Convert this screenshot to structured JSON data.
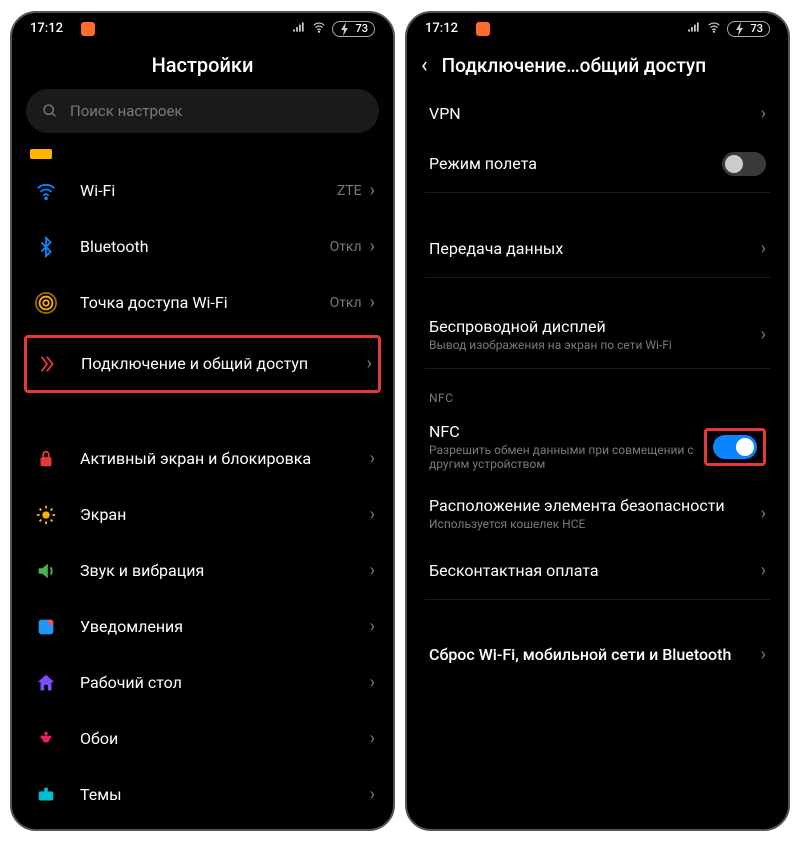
{
  "status": {
    "time": "17:12",
    "battery": "73"
  },
  "left_screen": {
    "title": "Настройки",
    "search_placeholder": "Поиск настроек",
    "items": {
      "wifi": {
        "label": "Wi-Fi",
        "value": "ZTE"
      },
      "bluetooth": {
        "label": "Bluetooth",
        "value": "Откл"
      },
      "hotspot": {
        "label": "Точка доступа Wi-Fi",
        "value": "Откл"
      },
      "sharing": {
        "label": "Подключение и общий доступ"
      },
      "lock": {
        "label": "Активный экран и блокировка"
      },
      "display": {
        "label": "Экран"
      },
      "sound": {
        "label": "Звук и вибрация"
      },
      "notif": {
        "label": "Уведомления"
      },
      "home": {
        "label": "Рабочий стол"
      },
      "wallpaper": {
        "label": "Обои"
      },
      "themes": {
        "label": "Темы"
      }
    }
  },
  "right_screen": {
    "title": "Подключение…общий доступ",
    "items": {
      "vpn": {
        "label": "VPN"
      },
      "airplane": {
        "label": "Режим полета"
      },
      "data": {
        "label": "Передача данных"
      },
      "cast": {
        "label": "Беспроводной дисплей",
        "sub": "Вывод изображения на экран по сети Wi-Fi"
      },
      "nfc_header": "NFC",
      "nfc": {
        "label": "NFC",
        "sub": "Разрешить обмен данными при совмещении с другим устройством"
      },
      "secure": {
        "label": "Расположение элемента безопасности",
        "sub": "Используется кошелек HCE"
      },
      "contactless": {
        "label": "Бесконтактная оплата"
      },
      "reset": {
        "label": "Сброс Wi-Fi, мобильной сети и Bluetooth"
      }
    }
  }
}
